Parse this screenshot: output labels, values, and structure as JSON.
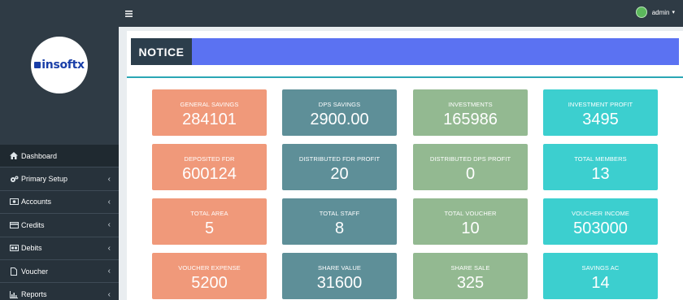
{
  "brand": {
    "logo_text": "insoftx"
  },
  "topbar": {
    "menu_icon": "hamburger-icon",
    "user_name": "admin"
  },
  "sidebar": {
    "items": [
      {
        "label": "Dashboard",
        "icon": "home-icon",
        "has_caret": false
      },
      {
        "label": "Primary Setup",
        "icon": "cogs-icon",
        "has_caret": true
      },
      {
        "label": "Accounts",
        "icon": "money-icon",
        "has_caret": true
      },
      {
        "label": "Credits",
        "icon": "credit-card-icon",
        "has_caret": true
      },
      {
        "label": "Debits",
        "icon": "debit-icon",
        "has_caret": true
      },
      {
        "label": "Voucher",
        "icon": "file-icon",
        "has_caret": true
      },
      {
        "label": "Reports",
        "icon": "bar-chart-icon",
        "has_caret": true
      }
    ]
  },
  "notice": {
    "label": "NOTICE"
  },
  "cards": [
    {
      "title": "GENERAL SAVINGS",
      "value": "284101"
    },
    {
      "title": "DPS SAVINGS",
      "value": "2900.00"
    },
    {
      "title": "INVESTMENTS",
      "value": "165986"
    },
    {
      "title": "INVESTMENT PROFIT",
      "value": "3495"
    },
    {
      "title": "DEPOSITED FDR",
      "value": "600124"
    },
    {
      "title": "DISTRIBUTED FDR PROFIT",
      "value": "20"
    },
    {
      "title": "DISTRIBUTED DPS PROFIT",
      "value": "0"
    },
    {
      "title": "TOTAL MEMBERS",
      "value": "13"
    },
    {
      "title": "TOTAL AREA",
      "value": "5"
    },
    {
      "title": "TOTAL STAFF",
      "value": "8"
    },
    {
      "title": "TOTAL VOUCHER",
      "value": "10"
    },
    {
      "title": "VOUCHER INCOME",
      "value": "503000"
    },
    {
      "title": "VOUCHER EXPENSE",
      "value": "5200"
    },
    {
      "title": "SHARE VALUE",
      "value": "31600"
    },
    {
      "title": "SHARE SALE",
      "value": "325"
    },
    {
      "title": "SAVINGS AC",
      "value": "14"
    }
  ],
  "colors": {
    "orange": "#f0997a",
    "slate": "#5e8f98",
    "green": "#93b991",
    "cyan": "#3ccfcf",
    "notice_bar": "#5b72f2"
  }
}
